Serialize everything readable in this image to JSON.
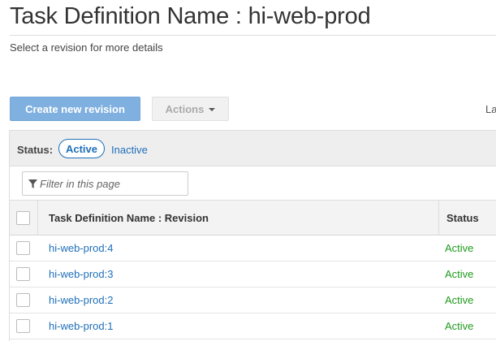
{
  "header": {
    "title": "Task Definition Name : hi-web-prod",
    "subtitle": "Select a revision for more details"
  },
  "toolbar": {
    "create_label": "Create new revision",
    "actions_label": "Actions",
    "last_label": "La"
  },
  "status_filter": {
    "label": "Status:",
    "active": "Active",
    "inactive": "Inactive"
  },
  "filter": {
    "placeholder": "Filter in this page",
    "icon": "filter-icon"
  },
  "table": {
    "columns": [
      "Task Definition Name : Revision",
      "Status"
    ],
    "rows": [
      {
        "name": "hi-web-prod:4",
        "status": "Active"
      },
      {
        "name": "hi-web-prod:3",
        "status": "Active"
      },
      {
        "name": "hi-web-prod:2",
        "status": "Active"
      },
      {
        "name": "hi-web-prod:1",
        "status": "Active"
      }
    ]
  },
  "colors": {
    "link": "#1e6fb8",
    "status_active": "#1d9b1d",
    "primary_button": "#7fb0df"
  }
}
